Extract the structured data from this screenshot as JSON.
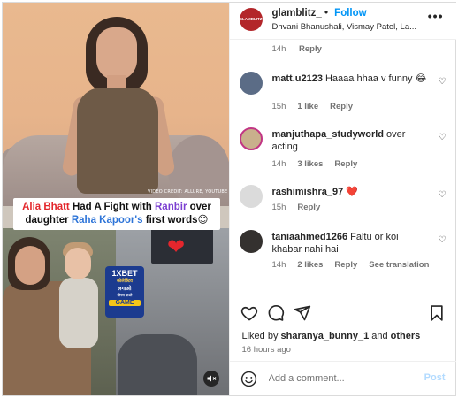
{
  "header": {
    "username": "glamblitz_",
    "separator": "•",
    "follow_label": "Follow",
    "tagged": "Dhvani Bhanushali, Vismay Patel, La...",
    "avatar_text": "GLAMBLITZ",
    "more_icon": "more-horizontal-icon"
  },
  "media": {
    "credit": "VIDEO CREDIT: ALLURE, YOUTUBE",
    "caption_parts": {
      "p1": "Alia Bhatt",
      "p2": " Had A Fight with ",
      "p3": "Ranbir",
      "p4": " over daughter ",
      "p5": "Raha Kapoor's",
      "p6": " first words",
      "emoji": "😊"
    },
    "ad": {
      "brand": "1XBET",
      "line1": "कोलेक्टिव",
      "line2": "लगाओ",
      "line3": "बोनस पाओ",
      "game": "GAME"
    },
    "heart": "❤",
    "mute_icon": "muted-speaker-icon"
  },
  "comments": {
    "top_meta": {
      "time": "14h",
      "reply": "Reply"
    },
    "items": [
      {
        "user": "matt.u2123",
        "text": "Haaaa hhaa v funny 😂",
        "time": "15h",
        "likes": "1 like",
        "reply": "Reply",
        "avatar_color": "#5b6c86"
      },
      {
        "user": "manjuthapa_studyworld",
        "text": "over acting",
        "time": "14h",
        "likes": "3 likes",
        "reply": "Reply",
        "avatar_color": "#c9b08c"
      },
      {
        "user": "rashimishra_97",
        "text": "❤️",
        "time": "15h",
        "likes": "",
        "reply": "Reply",
        "avatar_color": "#dbdbdb"
      },
      {
        "user": "taniaahmed1266",
        "text": "Faltu or koi khabar nahi hai",
        "time": "14h",
        "likes": "2 likes",
        "reply": "Reply",
        "see_translation": "See translation",
        "avatar_color": "#34312f"
      }
    ]
  },
  "actions": {
    "liked_by_prefix": "Liked by ",
    "liked_by_user": "sharanya_bunny_1",
    "liked_by_and": " and ",
    "liked_by_others": "others",
    "time_ago": "16 hours ago"
  },
  "composer": {
    "placeholder": "Add a comment...",
    "post_label": "Post"
  },
  "colors": {
    "accent": "#0095f6",
    "brand": "#b3262a",
    "caption_red": "#e3262b",
    "caption_purple": "#7b3fd1",
    "caption_blue": "#2d74d8"
  }
}
